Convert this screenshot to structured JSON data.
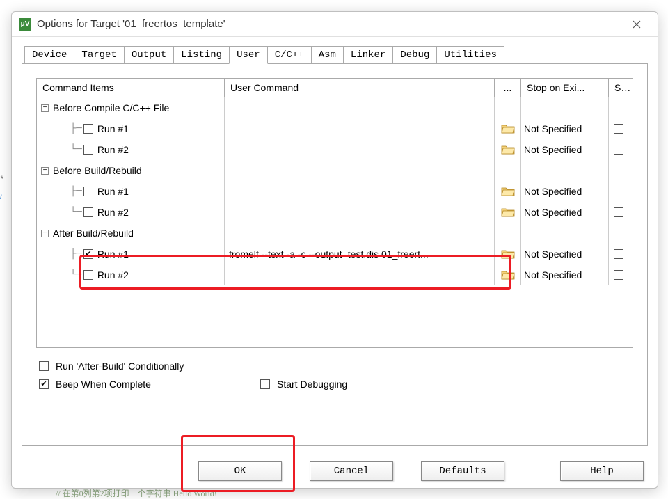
{
  "window": {
    "title": "Options for Target '01_freertos_template'",
    "app_icon_letter": "μV"
  },
  "tabs": [
    "Device",
    "Target",
    "Output",
    "Listing",
    "User",
    "C/C++",
    "Asm",
    "Linker",
    "Debug",
    "Utilities"
  ],
  "active_tab": "User",
  "grid": {
    "headers": {
      "cmd": "Command Items",
      "uc": "User Command",
      "dots": "...",
      "stop": "Stop on Exi...",
      "s": "S..."
    },
    "groups": [
      {
        "label": "Before Compile C/C++ File",
        "items": [
          {
            "label": "Run #1",
            "checked": false,
            "cmd": "",
            "stop": "Not Specified"
          },
          {
            "label": "Run #2",
            "checked": false,
            "cmd": "",
            "stop": "Not Specified"
          }
        ]
      },
      {
        "label": "Before Build/Rebuild",
        "items": [
          {
            "label": "Run #1",
            "checked": false,
            "cmd": "",
            "stop": "Not Specified"
          },
          {
            "label": "Run #2",
            "checked": false,
            "cmd": "",
            "stop": "Not Specified"
          }
        ]
      },
      {
        "label": "After Build/Rebuild",
        "items": [
          {
            "label": "Run #1",
            "checked": true,
            "cmd": "fromelf  --text  -a -c  --output=test.dis  01_freert...",
            "stop": "Not Specified"
          },
          {
            "label": "Run #2",
            "checked": false,
            "cmd": "",
            "stop": "Not Specified"
          }
        ]
      }
    ]
  },
  "opts": {
    "run_after_conditionally": {
      "label": "Run 'After-Build' Conditionally",
      "checked": false
    },
    "beep": {
      "label": "Beep When Complete",
      "checked": true
    },
    "start_debug": {
      "label": "Start Debugging",
      "checked": false
    }
  },
  "buttons": {
    "ok": "OK",
    "cancel": "Cancel",
    "defaults": "Defaults",
    "help": "Help"
  },
  "bg": {
    "star": "*",
    "i": "i",
    "bottom": "// 在第0列第2项打印一个字符串 Hello World!"
  }
}
